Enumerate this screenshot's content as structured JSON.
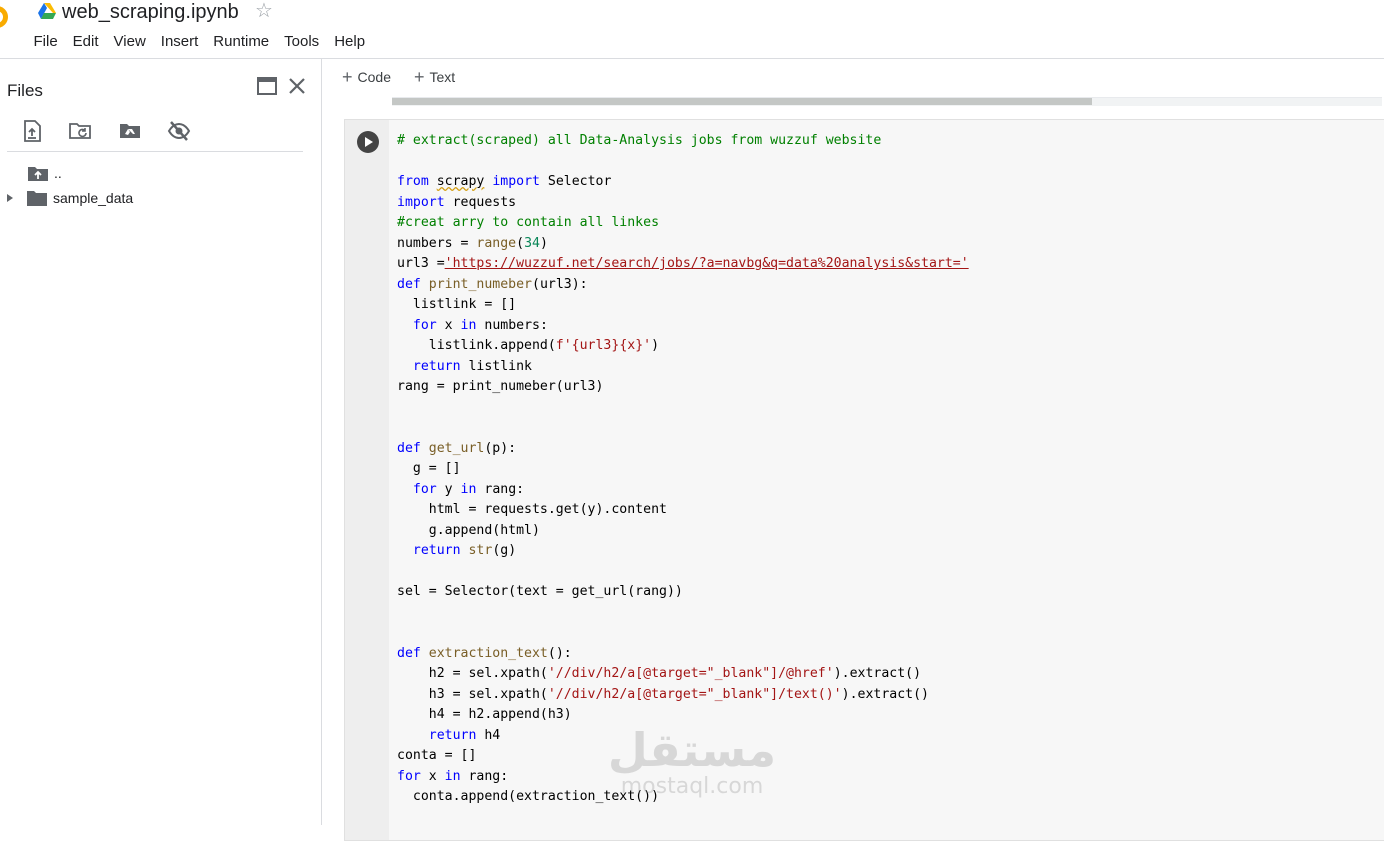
{
  "header": {
    "title": "web_scraping.ipynb",
    "menu": [
      "File",
      "Edit",
      "View",
      "Insert",
      "Runtime",
      "Tools",
      "Help"
    ]
  },
  "sidebar": {
    "title": "Files",
    "tree": [
      {
        "label": ".."
      },
      {
        "label": "sample_data"
      }
    ]
  },
  "main": {
    "add_code_label": "Code",
    "add_text_label": "Text"
  },
  "cell": {
    "lines": [
      "# extract(scraped) all Data-Analysis jobs from wuzzuf website",
      "",
      "from scrapy import Selector",
      "import requests",
      "#creat arry to contain all linkes",
      "numbers = range(34)",
      "url3 ='https://wuzzuf.net/search/jobs/?a=navbg&q=data%20analysis&start='",
      "def print_numeber(url3):",
      "  listlink = []",
      "  for x in numbers:",
      "    listlink.append(f'{url3}{x}')",
      "  return listlink",
      "rang = print_numeber(url3)",
      "",
      "",
      "def get_url(p):",
      "  g = []",
      "  for y in rang:",
      "    html = requests.get(y).content",
      "    g.append(html)",
      "  return str(g)",
      "",
      "sel = Selector(text = get_url(rang))",
      "",
      "",
      "def extraction_text():",
      "    h2 = sel.xpath('//div/h2/a[@target=\"_blank\"]/@href').extract()",
      "    h3 = sel.xpath('//div/h2/a[@target=\"_blank\"]/text()').extract()",
      "    h4 = h2.append(h3)",
      "    return h4",
      "conta = []",
      "for x in rang:",
      "  conta.append(extraction_text())"
    ]
  },
  "watermark": {
    "arabic": "مستقل",
    "latin": "mostaql.com"
  }
}
